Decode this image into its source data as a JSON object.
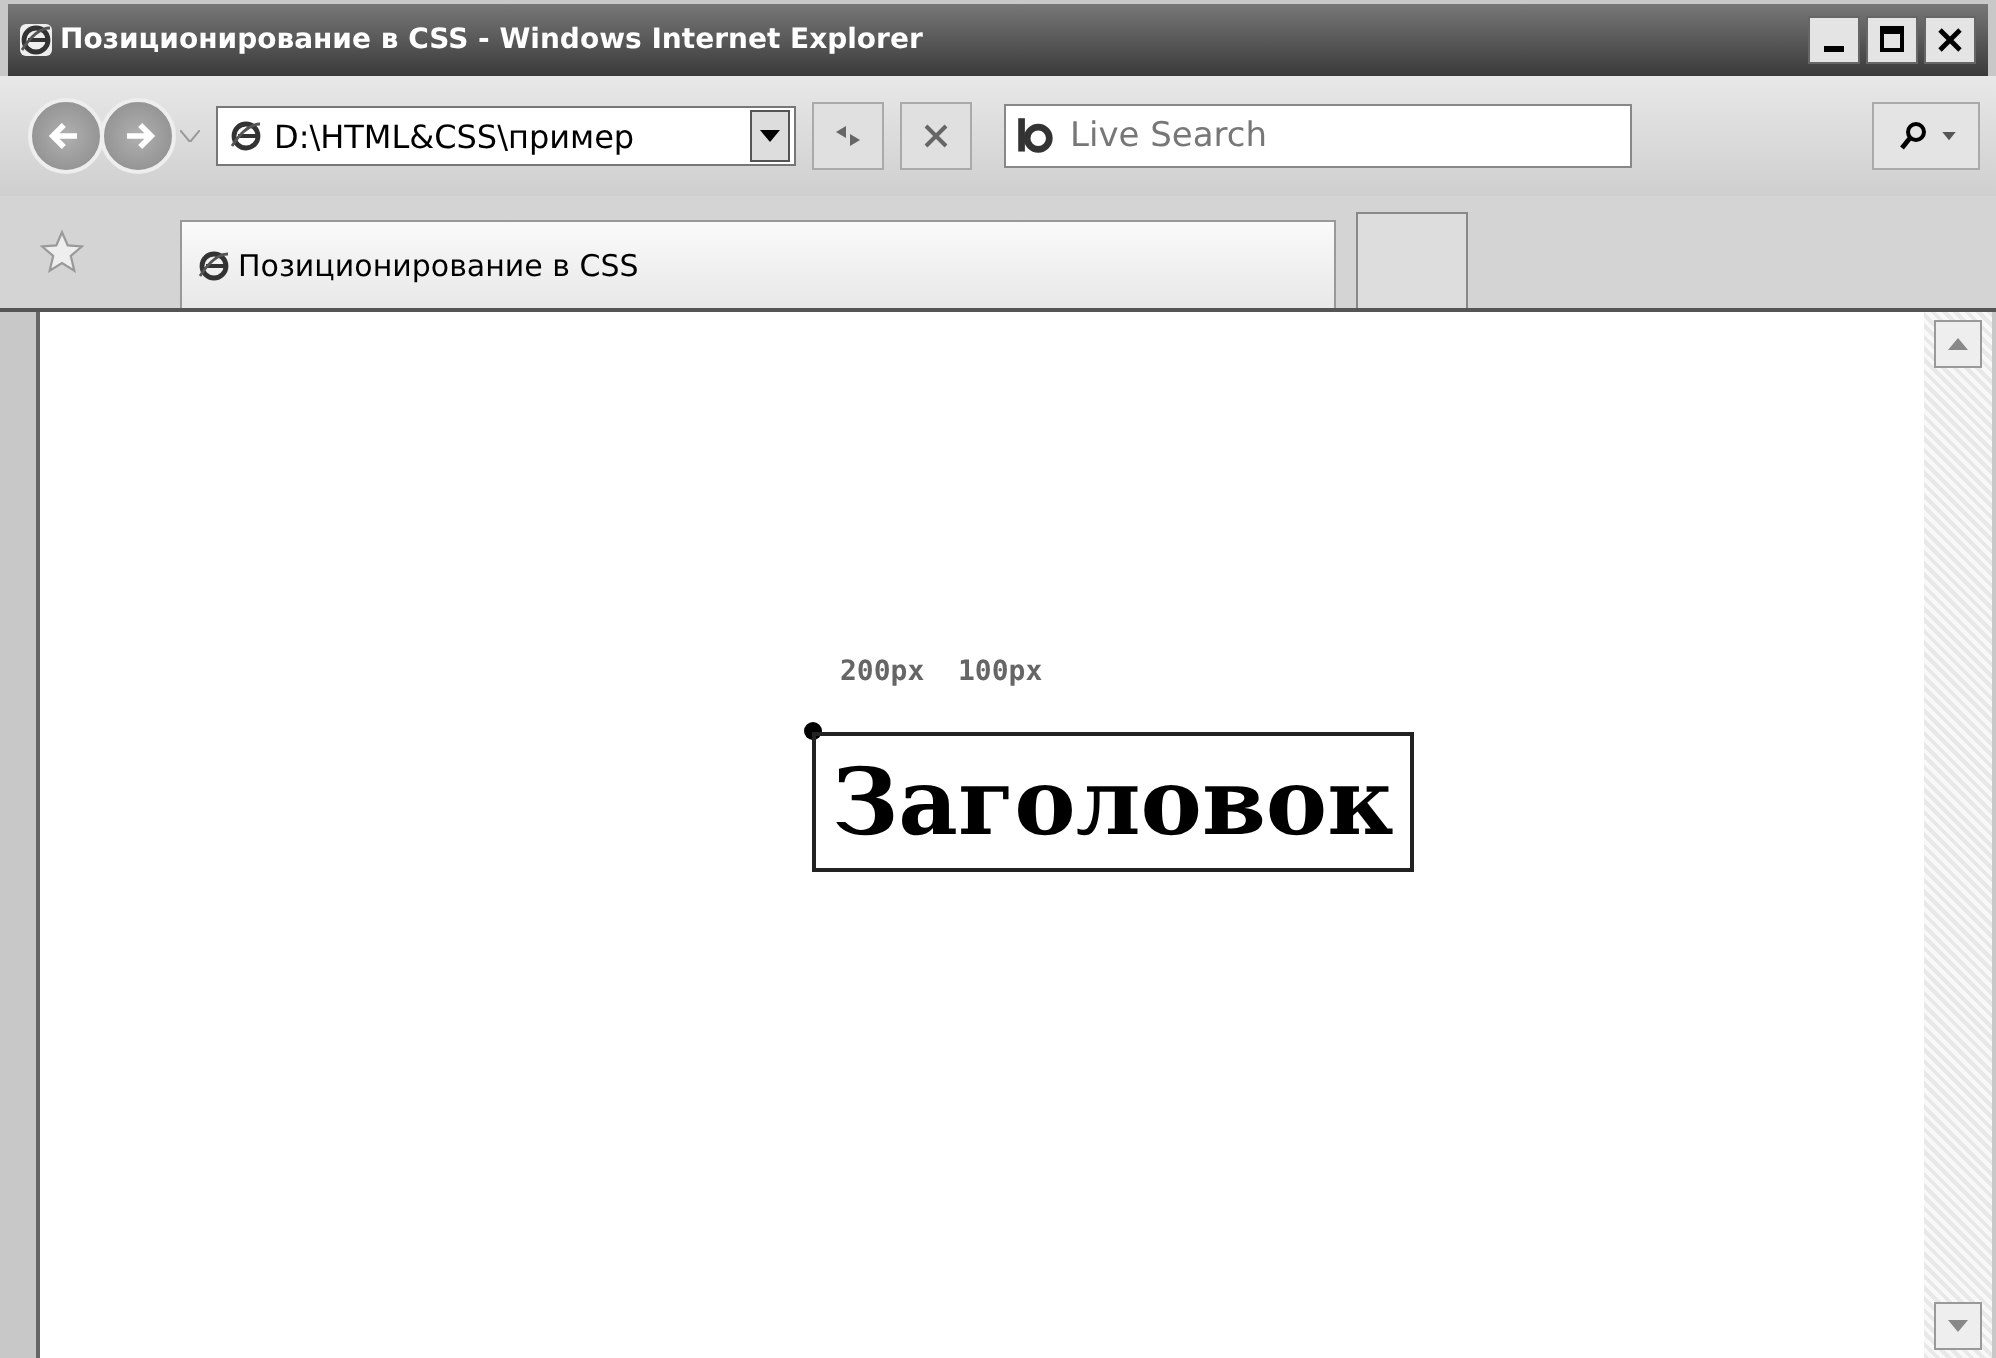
{
  "window": {
    "title": "Позиционирование в CSS - Windows Internet Explorer"
  },
  "address_bar": {
    "value": "D:\\HTML&CSS\\пример"
  },
  "search": {
    "placeholder": "Live Search"
  },
  "tabs": [
    {
      "label": "Позиционирование в CSS",
      "selected": true
    }
  ],
  "page": {
    "coordinates_label": "200px  100px",
    "heading": "Заголовок"
  }
}
